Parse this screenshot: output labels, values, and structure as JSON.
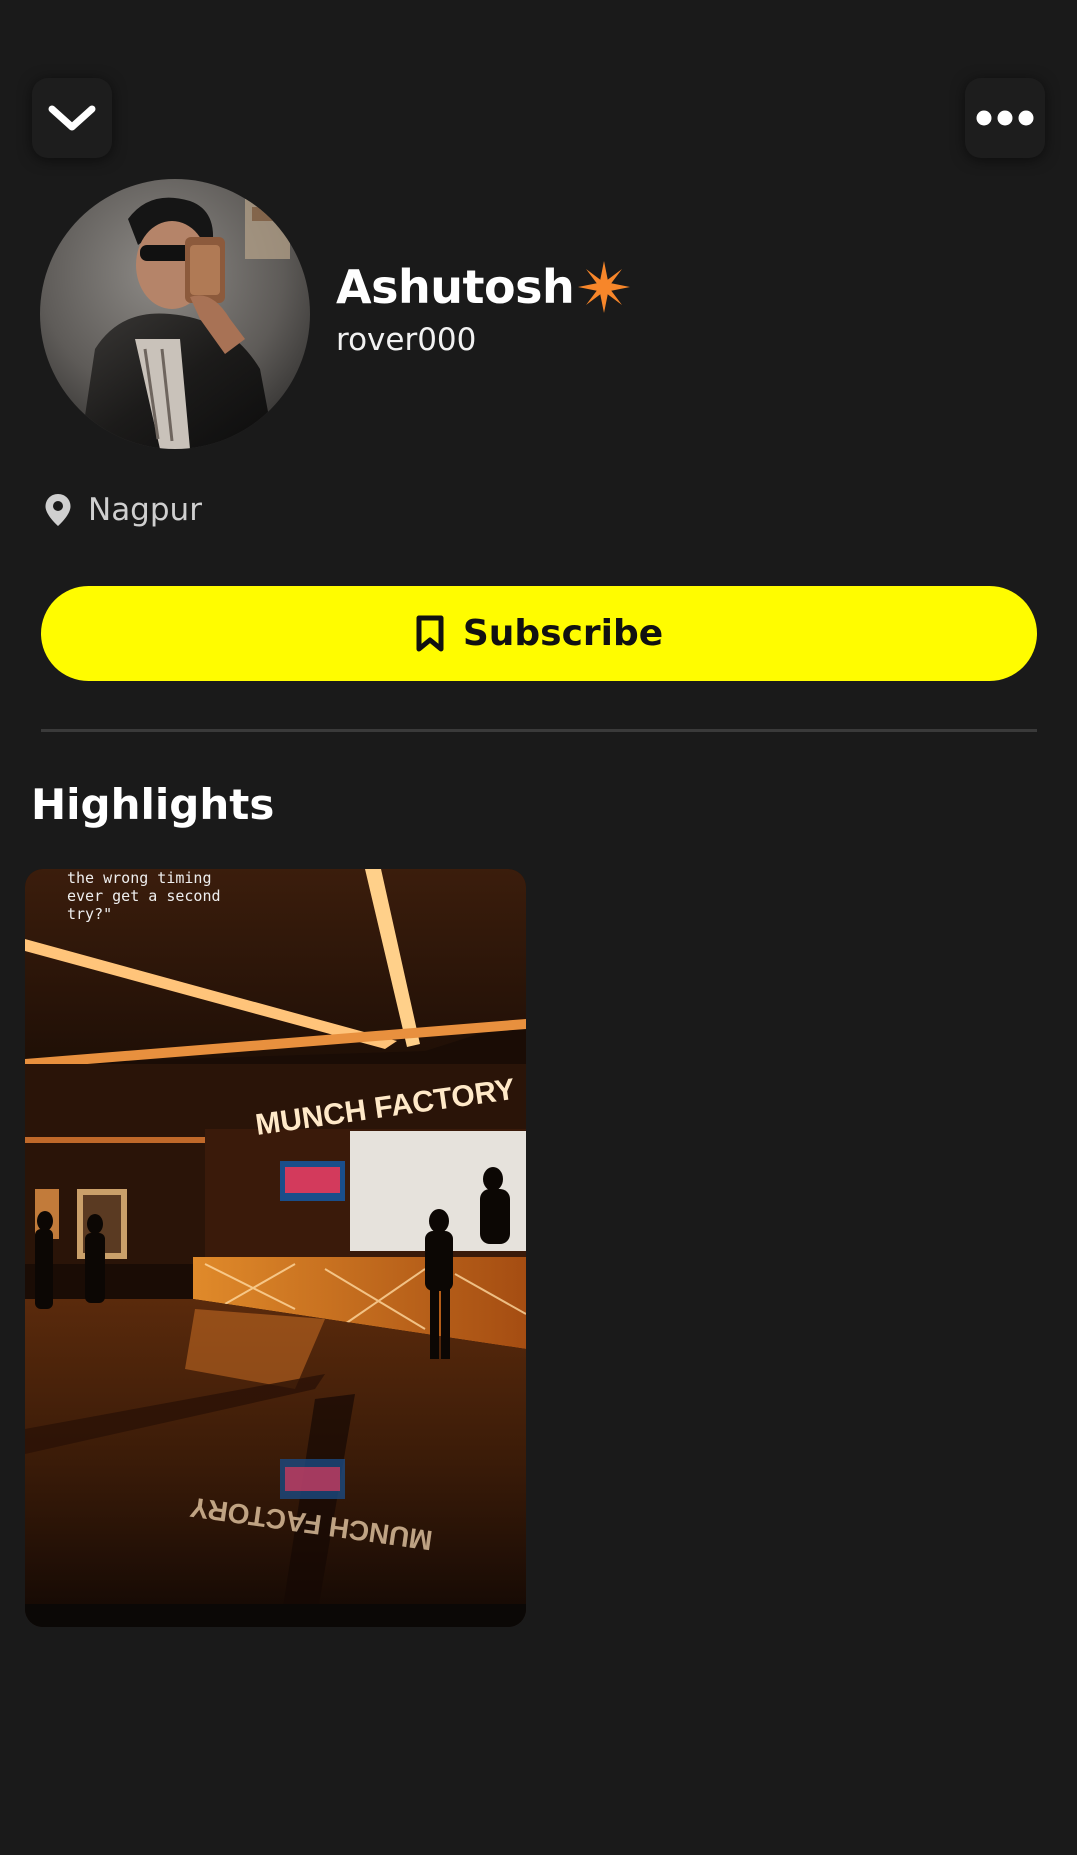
{
  "header": {
    "back_icon": "chevron-down-icon",
    "more_icon": "more-horizontal-icon"
  },
  "profile": {
    "display_name": "Ashutosh",
    "name_emoji": "sparkle-star-icon",
    "username": "rover000",
    "location": "Nagpur",
    "location_icon": "map-pin-icon"
  },
  "subscribe": {
    "label": "Subscribe",
    "icon": "bookmark-icon",
    "color": "#fffc00"
  },
  "highlights": {
    "title": "Highlights",
    "items": [
      {
        "caption": "the wrong timing\never get a second\ntry?\"",
        "sign_text": "MUNCH FACTORY"
      }
    ]
  },
  "colors": {
    "background": "#1a1a1a",
    "accent": "#fffc00",
    "emoji_orange": "#f7862a"
  }
}
